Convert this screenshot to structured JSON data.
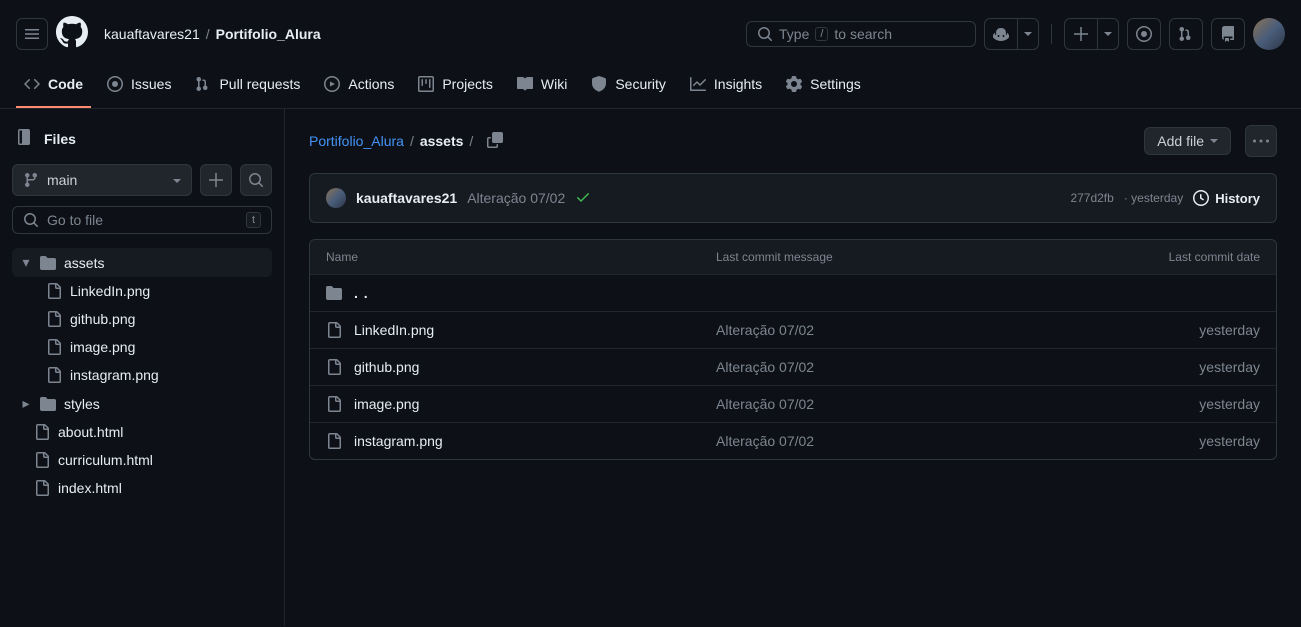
{
  "header": {
    "owner": "kauaftavares21",
    "repo": "Portifolio_Alura",
    "search_placeholder_prefix": "Type",
    "search_placeholder_suffix": "to search",
    "search_key": "/"
  },
  "nav": {
    "code": "Code",
    "issues": "Issues",
    "pulls": "Pull requests",
    "actions": "Actions",
    "projects": "Projects",
    "wiki": "Wiki",
    "security": "Security",
    "insights": "Insights",
    "settings": "Settings"
  },
  "sidebar": {
    "title": "Files",
    "branch": "main",
    "file_search_placeholder": "Go to file",
    "file_search_key": "t",
    "tree": {
      "assets": "assets",
      "assets_children": [
        "LinkedIn.png",
        "github.png",
        "image.png",
        "instagram.png"
      ],
      "styles": "styles",
      "root_files": [
        "about.html",
        "curriculum.html",
        "index.html"
      ]
    }
  },
  "content": {
    "path_repo": "Portifolio_Alura",
    "path_current": "assets",
    "add_file": "Add file",
    "commit": {
      "author": "kauaftavares21",
      "message": "Alteração 07/02",
      "sha": "277d2fb",
      "time": "yesterday",
      "history": "History"
    },
    "table": {
      "col_name": "Name",
      "col_msg": "Last commit message",
      "col_date": "Last commit date",
      "parent": ". .",
      "rows": [
        {
          "name": "LinkedIn.png",
          "msg": "Alteração 07/02",
          "date": "yesterday"
        },
        {
          "name": "github.png",
          "msg": "Alteração 07/02",
          "date": "yesterday"
        },
        {
          "name": "image.png",
          "msg": "Alteração 07/02",
          "date": "yesterday"
        },
        {
          "name": "instagram.png",
          "msg": "Alteração 07/02",
          "date": "yesterday"
        }
      ]
    }
  }
}
